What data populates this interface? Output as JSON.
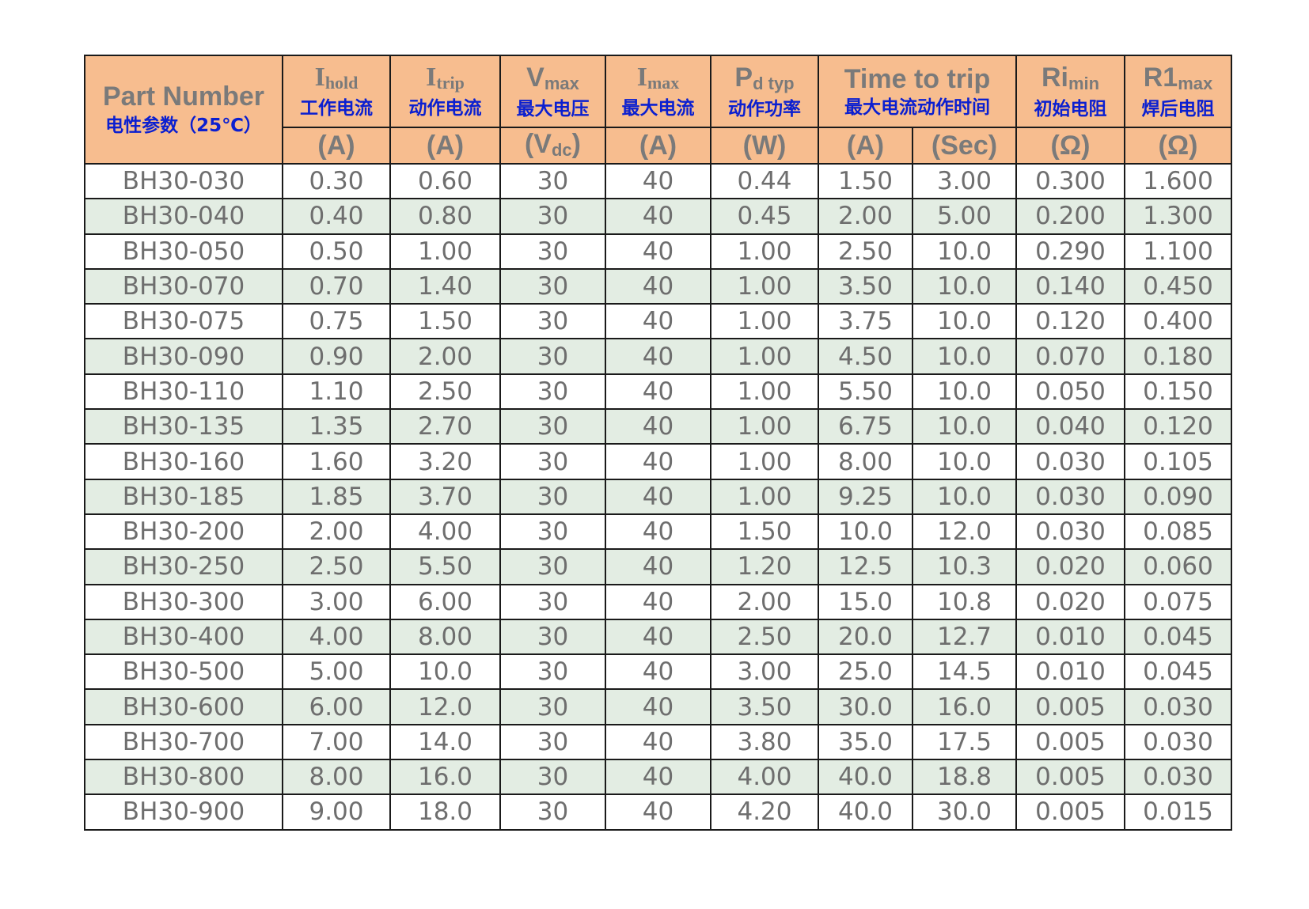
{
  "header": {
    "part_number": "Part Number",
    "part_number_sub": "电性参数（25℃）",
    "columns": [
      {
        "sym": "I",
        "sub": "hold",
        "cn": "工作电流",
        "unit": "(A)"
      },
      {
        "sym": "I",
        "sub": "trip",
        "cn": "动作电流",
        "unit": "(A)"
      },
      {
        "sym": "V",
        "sub": "max",
        "cn": "最大电压",
        "unit_pre": "(V",
        "unit_sub": "dc",
        "unit_post": ")"
      },
      {
        "sym": "I",
        "sub": "max",
        "cn": "最大电流",
        "unit": "(A)"
      },
      {
        "sym": "P",
        "sub": "d typ",
        "cn": "动作功率",
        "unit": "(W)"
      },
      {
        "sym": "Time to trip",
        "cn": "最大电流动作时间",
        "unit_a": "(A)",
        "unit_b": "(Sec)"
      },
      {
        "sym": "Ri",
        "sub": "min",
        "cn": "初始电阻",
        "unit": "(Ω)"
      },
      {
        "sym": "R1",
        "sub": "max",
        "cn": "焊后电阻",
        "unit": "(Ω)"
      }
    ]
  },
  "rows": [
    [
      "BH30-030",
      "0.30",
      "0.60",
      "30",
      "40",
      "0.44",
      "1.50",
      "3.00",
      "0.300",
      "1.600"
    ],
    [
      "BH30-040",
      "0.40",
      "0.80",
      "30",
      "40",
      "0.45",
      "2.00",
      "5.00",
      "0.200",
      "1.300"
    ],
    [
      "BH30-050",
      "0.50",
      "1.00",
      "30",
      "40",
      "1.00",
      "2.50",
      "10.0",
      "0.290",
      "1.100"
    ],
    [
      "BH30-070",
      "0.70",
      "1.40",
      "30",
      "40",
      "1.00",
      "3.50",
      "10.0",
      "0.140",
      "0.450"
    ],
    [
      "BH30-075",
      "0.75",
      "1.50",
      "30",
      "40",
      "1.00",
      "3.75",
      "10.0",
      "0.120",
      "0.400"
    ],
    [
      "BH30-090",
      "0.90",
      "2.00",
      "30",
      "40",
      "1.00",
      "4.50",
      "10.0",
      "0.070",
      "0.180"
    ],
    [
      "BH30-110",
      "1.10",
      "2.50",
      "30",
      "40",
      "1.00",
      "5.50",
      "10.0",
      "0.050",
      "0.150"
    ],
    [
      "BH30-135",
      "1.35",
      "2.70",
      "30",
      "40",
      "1.00",
      "6.75",
      "10.0",
      "0.040",
      "0.120"
    ],
    [
      "BH30-160",
      "1.60",
      "3.20",
      "30",
      "40",
      "1.00",
      "8.00",
      "10.0",
      "0.030",
      "0.105"
    ],
    [
      "BH30-185",
      "1.85",
      "3.70",
      "30",
      "40",
      "1.00",
      "9.25",
      "10.0",
      "0.030",
      "0.090"
    ],
    [
      "BH30-200",
      "2.00",
      "4.00",
      "30",
      "40",
      "1.50",
      "10.0",
      "12.0",
      "0.030",
      "0.085"
    ],
    [
      "BH30-250",
      "2.50",
      "5.50",
      "30",
      "40",
      "1.20",
      "12.5",
      "10.3",
      "0.020",
      "0.060"
    ],
    [
      "BH30-300",
      "3.00",
      "6.00",
      "30",
      "40",
      "2.00",
      "15.0",
      "10.8",
      "0.020",
      "0.075"
    ],
    [
      "BH30-400",
      "4.00",
      "8.00",
      "30",
      "40",
      "2.50",
      "20.0",
      "12.7",
      "0.010",
      "0.045"
    ],
    [
      "BH30-500",
      "5.00",
      "10.0",
      "30",
      "40",
      "3.00",
      "25.0",
      "14.5",
      "0.010",
      "0.045"
    ],
    [
      "BH30-600",
      "6.00",
      "12.0",
      "30",
      "40",
      "3.50",
      "30.0",
      "16.0",
      "0.005",
      "0.030"
    ],
    [
      "BH30-700",
      "7.00",
      "14.0",
      "30",
      "40",
      "3.80",
      "35.0",
      "17.5",
      "0.005",
      "0.030"
    ],
    [
      "BH30-800",
      "8.00",
      "16.0",
      "30",
      "40",
      "4.00",
      "40.0",
      "18.8",
      "0.005",
      "0.030"
    ],
    [
      "BH30-900",
      "9.00",
      "18.0",
      "30",
      "40",
      "4.20",
      "40.0",
      "30.0",
      "0.005",
      "0.015"
    ]
  ]
}
